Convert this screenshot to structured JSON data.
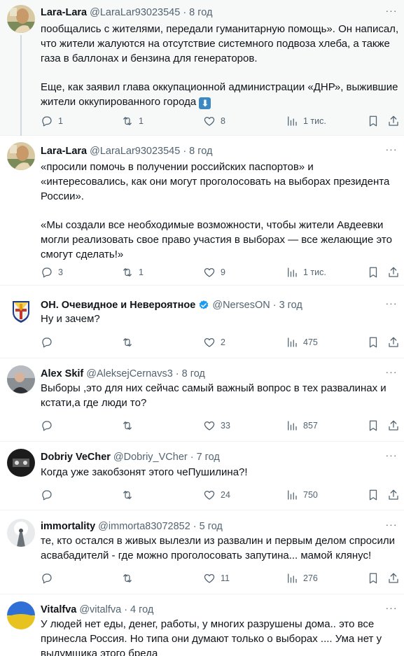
{
  "tweets": [
    {
      "name": "Lara-Lara",
      "handle": "@LaraLar93023545",
      "time": "8 год",
      "text": "пообщались с жителями, передали гуманитарную помощь». Он написал,\nчто жители жалуются на отсутствие системного подвоза хлеба, а также\nгаза в баллонах и бензина для генераторов.\n\nЕще, как заявил глава оккупационной администрации «ДНР», выжившие\nжители оккупированного города",
      "emoji": "⬇",
      "replies": "1",
      "reposts": "1",
      "likes": "8",
      "views": "1 тис."
    },
    {
      "name": "Lara-Lara",
      "handle": "@LaraLar93023545",
      "time": "8 год",
      "text": "«просили помочь в получении российских паспортов» и\n«интересовались, как они могут проголосовать на выборах президента\nРоссии».\n\n«Мы создали все необходимые возможности, чтобы жители Авдеевки\nмогли реализовать свое право участия в выборах — все желающие это\nсмогут сделать!»",
      "replies": "3",
      "reposts": "1",
      "likes": "9",
      "views": "1 тис."
    },
    {
      "name": "ОН. Очевидное и Невероятное",
      "handle": "@NersesON",
      "time": "3 год",
      "text": "Ну и зачем?",
      "replies": "",
      "reposts": "",
      "likes": "2",
      "views": "475"
    },
    {
      "name": "Alex Skif",
      "handle": "@AleksejCernavs3",
      "time": "8 год",
      "text": "Выборы ,это для них сейчас самый важный вопрос в тех развалинах и\nкстати,а где люди то?",
      "replies": "",
      "reposts": "",
      "likes": "33",
      "views": "857"
    },
    {
      "name": "Dobriy VeCher",
      "handle": "@Dobriy_VCher",
      "time": "7 год",
      "text": "Когда уже закобзонят этого чеПушилина?!",
      "replies": "",
      "reposts": "",
      "likes": "24",
      "views": "750"
    },
    {
      "name": "immortality",
      "handle": "@immorta83072852",
      "time": "5 год",
      "text": "те, кто остался в живых вылезли из развалин и первым делом спросили\nасвабадителй - где можно проголосовать запутина... мамой клянус!",
      "replies": "",
      "reposts": "",
      "likes": "11",
      "views": "276"
    },
    {
      "name": "Vitalfva",
      "handle": "@vitalfva",
      "time": "4 год",
      "text": "У людей нет еды, денег, работы, у многих разрушены дома.. это все\nпринесла Россия. Но типа они думают только о выборах .... Ума нет у\nвыдумщика этого бреда"
    }
  ],
  "colors": {
    "accent": "#1d9bf0",
    "muted": "#536471",
    "text": "#0f1419",
    "divider": "#eff3f4"
  },
  "icons": [
    "reply-icon",
    "repost-icon",
    "like-icon",
    "views-icon",
    "bookmark-icon",
    "share-icon",
    "more-icon",
    "verified-icon"
  ]
}
